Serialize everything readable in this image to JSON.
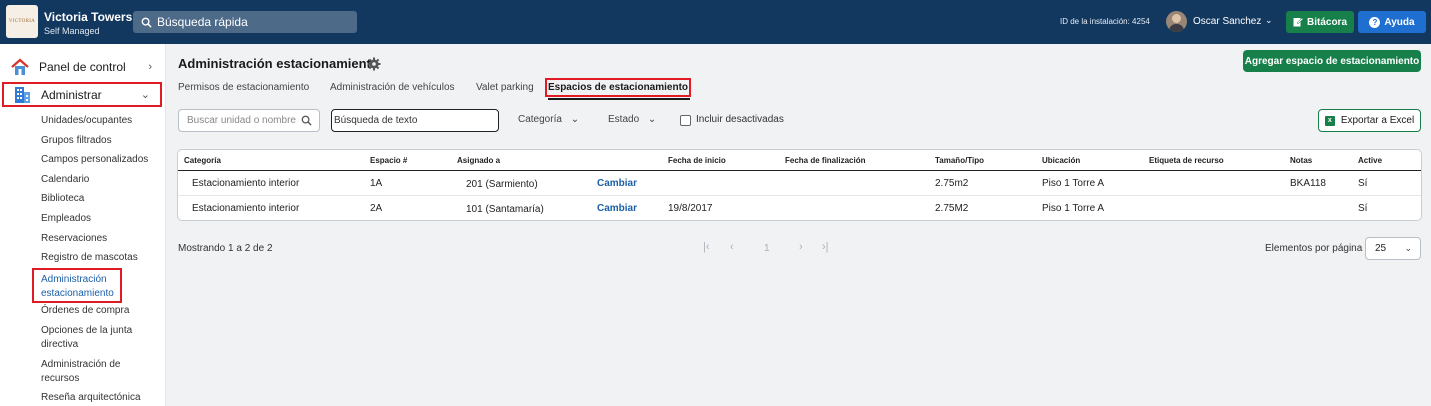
{
  "header": {
    "logo_text": "VICTORIA",
    "brand_name": "Victoria Towers",
    "brand_sub": "Self Managed",
    "search_placeholder": "Búsqueda rápida",
    "install_id": "ID de la instalación: 4254",
    "user_name": "Oscar Sanchez",
    "bitacora_label": "Bitácora",
    "ayuda_label": "Ayuda"
  },
  "sidebar": {
    "panel_label": "Panel de control",
    "admin_label": "Administrar",
    "items": [
      "Unidades/ocupantes",
      "Grupos filtrados",
      "Campos personalizados",
      "Calendario",
      "Biblioteca",
      "Empleados",
      "Reservaciones",
      "Registro de mascotas"
    ],
    "active_item_line1": "Administración",
    "active_item_line2": "estacionamiento",
    "items_after": {
      "ordenes": "Órdenes de compra",
      "junta_1": "Opciones de la junta",
      "junta_2": "directiva",
      "recursos_1": "Administración de",
      "recursos_2": "recursos",
      "resena": "Reseña arquitectónica"
    }
  },
  "main": {
    "title": "Administración estacionamiento",
    "add_button": "Agregar espacio de estacionamiento",
    "tabs": [
      "Permisos de estacionamiento",
      "Administración de vehículos",
      "Valet parking",
      "Espacios de estacionamiento"
    ],
    "filters": {
      "unit_placeholder": "Buscar unidad o nombre",
      "text_placeholder": "Búsqueda de texto",
      "categoria": "Categoría",
      "estado": "Estado",
      "include_label": "Incluir desactivadas",
      "export_label": "Exportar a Excel"
    },
    "table": {
      "headers": {
        "categoria": "Categoría",
        "espacio": "Espacio #",
        "asignado": "Asignado a",
        "inicio": "Fecha de inicio",
        "fin": "Fecha de finalización",
        "tamano": "Tamaño/Tipo",
        "ubicacion": "Ubicación",
        "etiqueta": "Etiqueta de recurso",
        "notas": "Notas",
        "active": "Active"
      },
      "rows": [
        {
          "categoria": "Estacionamiento interior",
          "espacio": "1A",
          "asignado": "201 (Sarmiento)",
          "action": "Cambiar",
          "inicio": "",
          "fin": "",
          "tamano": "2.75m2",
          "ubicacion": "Piso 1 Torre A",
          "etiqueta": "",
          "notas": "BKA118",
          "active": "Sí"
        },
        {
          "categoria": "Estacionamiento interior",
          "espacio": "2A",
          "asignado": "101 (Santamaría)",
          "action": "Cambiar",
          "inicio": "19/8/2017",
          "fin": "",
          "tamano": "2.75M2",
          "ubicacion": "Piso 1 Torre A",
          "etiqueta": "",
          "notas": "",
          "active": "Sí"
        }
      ]
    },
    "footer": {
      "showing": "Mostrando 1 a 2 de 2",
      "page": "1",
      "per_page_label": "Elementos por página",
      "per_page_value": "25"
    }
  }
}
